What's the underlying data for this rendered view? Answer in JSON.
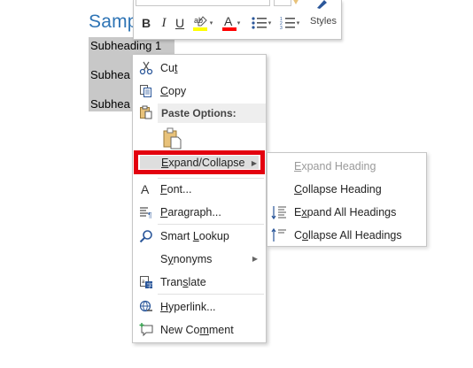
{
  "document": {
    "heading": "Samp",
    "lines": [
      "Subheading 1",
      "Subhea",
      "Subhea"
    ]
  },
  "mini_toolbar": {
    "bold": "B",
    "italic": "I",
    "underline": "U",
    "font_color_glyph": "A",
    "styles_label": "Styles"
  },
  "context_menu": {
    "items": [
      {
        "label": "Cut",
        "accel": "t",
        "icon": "scissors-icon"
      },
      {
        "label": "Copy",
        "accel": "C",
        "icon": "copy-icon"
      },
      {
        "label": "Paste Options:",
        "icon": "clipboard-icon"
      },
      {
        "label": "Expand/Collapse",
        "accel": "E",
        "icon": "",
        "has_submenu": true,
        "highlighted": true
      },
      {
        "label": "Font...",
        "accel": "F",
        "icon": "font-icon"
      },
      {
        "label": "Paragraph...",
        "accel": "P",
        "icon": "paragraph-icon"
      },
      {
        "label": "Smart Lookup",
        "accel": "L",
        "icon": "smart-lookup-icon"
      },
      {
        "label": "Synonyms",
        "accel": "y",
        "icon": "",
        "has_submenu": true
      },
      {
        "label": "Translate",
        "accel": "s",
        "icon": "translate-icon"
      },
      {
        "label": "Hyperlink...",
        "accel": "H",
        "icon": "hyperlink-icon"
      },
      {
        "label": "New Comment",
        "accel": "m",
        "icon": "new-comment-icon"
      }
    ]
  },
  "submenu": {
    "items": [
      {
        "label": "Expand Heading",
        "accel": "E",
        "disabled": true,
        "icon": ""
      },
      {
        "label": "Collapse Heading",
        "accel": "C",
        "disabled": false,
        "icon": ""
      },
      {
        "label": "Expand All Headings",
        "accel": "x",
        "disabled": false,
        "icon": "expand-all-icon"
      },
      {
        "label": "Collapse All Headings",
        "accel": "o",
        "disabled": false,
        "icon": "collapse-all-icon"
      }
    ]
  },
  "colors": {
    "highlight_outline": "#e3000f",
    "heading_blue": "#2e74b5",
    "icon_blue": "#2b579a",
    "highlighter_yellow": "#ffff00",
    "font_red": "#ff0000"
  }
}
